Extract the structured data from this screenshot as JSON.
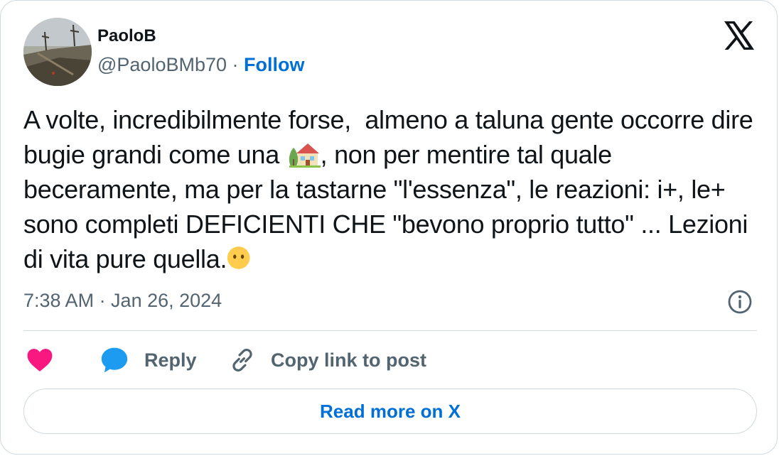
{
  "author": {
    "display_name": "PaoloB",
    "handle": "@PaoloBMb70",
    "separator": " · ",
    "follow_label": "Follow"
  },
  "tweet": {
    "text_part1": "A volte, incredibilmente forse,  almeno a taluna gente occorre dire bugie grandi come una ",
    "emoji_house": "house-with-garden",
    "text_part2": ", non per mentire tal quale beceramente, ma per la tastarne \"l'essenza\", le reazioni: i+, le+ sono completi DEFICIENTI CHE \"bevono proprio tutto\" ... Lezioni di vita pure quella.",
    "emoji_face": "face-without-mouth"
  },
  "meta": {
    "timestamp": "7:38 AM · Jan 26, 2024"
  },
  "actions": {
    "like_icon": "heart-icon",
    "reply_label": "Reply",
    "copy_label": "Copy link to post"
  },
  "footer": {
    "read_more_label": "Read more on X"
  },
  "colors": {
    "text": "#0f1419",
    "muted": "#536471",
    "link": "#006fd6",
    "like": "#f91880",
    "reply": "#1d9bf0",
    "border": "#cfd9de"
  }
}
